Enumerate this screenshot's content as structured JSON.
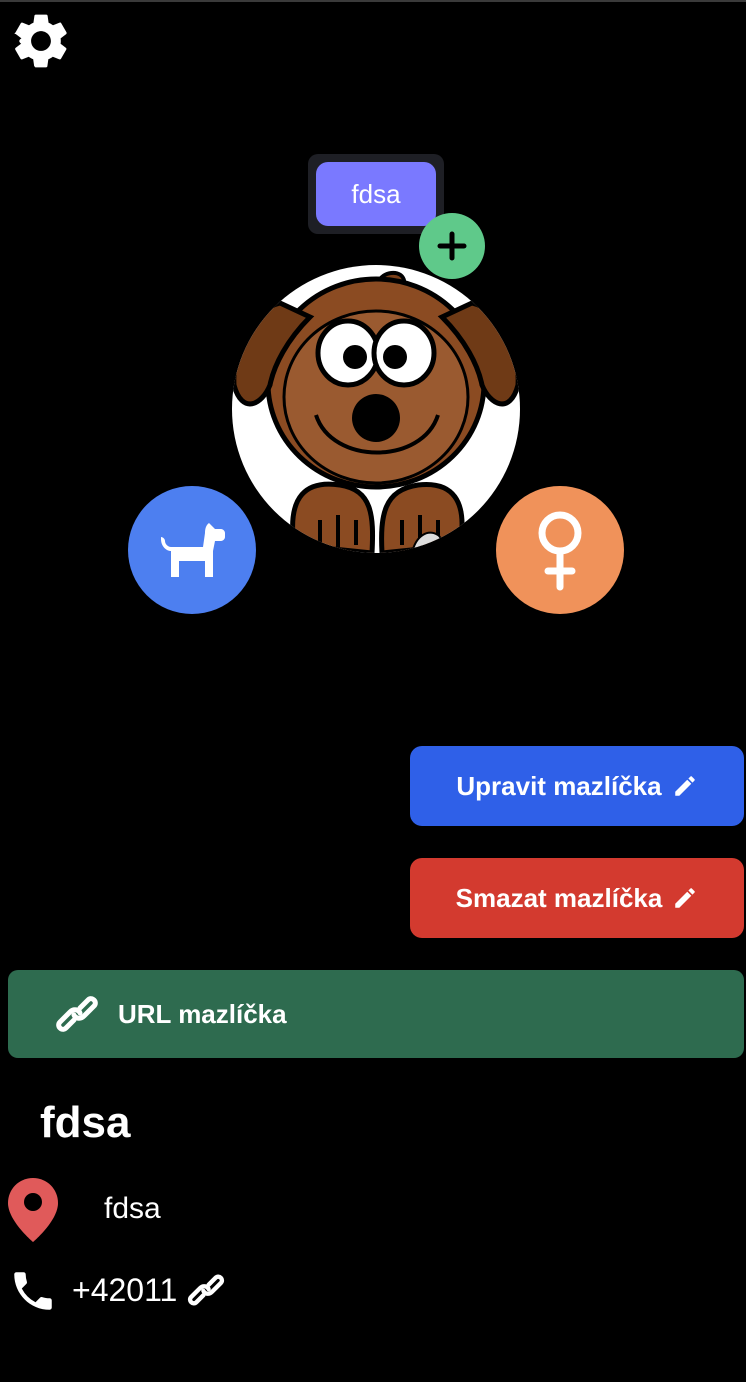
{
  "header": {
    "settings_icon": "gear-icon"
  },
  "pet_tag": {
    "label": "fdsa",
    "add_icon": "plus-icon",
    "add_color": "#5fc98a"
  },
  "avatar": {
    "image": "cartoon-dog-image"
  },
  "badges": {
    "species": {
      "icon": "dog-icon",
      "color": "#4d7ff0"
    },
    "gender": {
      "icon": "female-icon",
      "color": "#f0925a"
    }
  },
  "actions": {
    "edit_label": "Upravit mazlíčka",
    "edit_icon": "pencil-icon",
    "delete_label": "Smazat mazlíčka",
    "delete_icon": "pencil-icon",
    "url_label": "URL mazlíčka",
    "url_icon": "link-icon"
  },
  "details": {
    "name": "fdsa",
    "location": "fdsa",
    "location_icon": "map-pin-icon",
    "phone": "+42011",
    "phone_icon": "phone-icon",
    "phone_link_icon": "link-icon"
  },
  "colors": {
    "background": "#000000",
    "edit": "#2f60e8",
    "delete": "#d33a2f",
    "url": "#2e6b4f",
    "tag": "#7a79ff"
  }
}
